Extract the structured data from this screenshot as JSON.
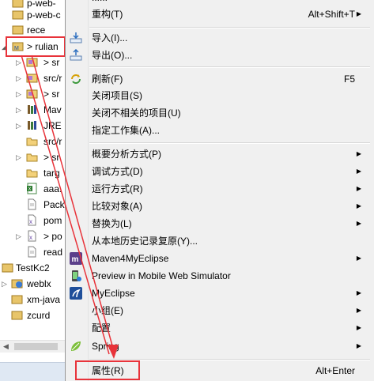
{
  "tree": {
    "items": [
      {
        "label": "p-web-",
        "icon": "project-icon"
      },
      {
        "label": "p-web-c",
        "icon": "project-icon"
      },
      {
        "label": "rece",
        "icon": "project-icon"
      },
      {
        "label": "> rulian",
        "icon": "project-icon"
      },
      {
        "label": "> sr",
        "icon": "package-icon"
      },
      {
        "label": "src/r",
        "icon": "package-icon"
      },
      {
        "label": "> sr",
        "icon": "package-icon"
      },
      {
        "label": "Mav",
        "icon": "library-icon"
      },
      {
        "label": "JRE",
        "icon": "library-icon"
      },
      {
        "label": "src/r",
        "icon": "folder-icon"
      },
      {
        "label": "> sr",
        "icon": "folder-icon"
      },
      {
        "label": "targ",
        "icon": "folder-icon"
      },
      {
        "label": "aaa.",
        "icon": "excel-file-icon"
      },
      {
        "label": "Pack",
        "icon": "file-icon"
      },
      {
        "label": "pom",
        "icon": "xml-file-icon"
      },
      {
        "label": "> po",
        "icon": "xml-file-icon"
      },
      {
        "label": "read",
        "icon": "file-icon"
      },
      {
        "label": "TestKc2",
        "icon": "project-icon"
      },
      {
        "label": "weblx",
        "icon": "web-project-icon"
      },
      {
        "label": "xm-java",
        "icon": "project-icon"
      },
      {
        "label": "zcurd",
        "icon": "project-icon"
      }
    ]
  },
  "menu": {
    "top_partial": "......",
    "refactor": {
      "label": "重构(T)",
      "accel": "Alt+Shift+T"
    },
    "import": {
      "label": "导入(I)..."
    },
    "export": {
      "label": "导出(O)..."
    },
    "refresh": {
      "label": "刷新(F)",
      "accel": "F5"
    },
    "close_project": {
      "label": "关闭项目(S)"
    },
    "close_unrelated": {
      "label": "关闭不相关的项目(U)"
    },
    "working_set": {
      "label": "指定工作集(A)..."
    },
    "profile_as": {
      "label": "概要分析方式(P)"
    },
    "debug_as": {
      "label": "调试方式(D)"
    },
    "run_as": {
      "label": "运行方式(R)"
    },
    "compare_with": {
      "label": "比较对象(A)"
    },
    "replace_with": {
      "label": "替换为(L)"
    },
    "restore_history": {
      "label": "从本地历史记录复原(Y)..."
    },
    "maven4": {
      "label": "Maven4MyEclipse"
    },
    "preview_mobile": {
      "label": "Preview in Mobile Web Simulator"
    },
    "myeclipse": {
      "label": "MyEclipse"
    },
    "team": {
      "label": "小组(E)"
    },
    "configure": {
      "label": "配置"
    },
    "spring": {
      "label": "Spring"
    },
    "properties": {
      "label": "属性(R)",
      "accel": "Alt+Enter"
    }
  },
  "colors": {
    "highlight_border": "#e8333a",
    "menu_bg": "#f0f0f0"
  }
}
